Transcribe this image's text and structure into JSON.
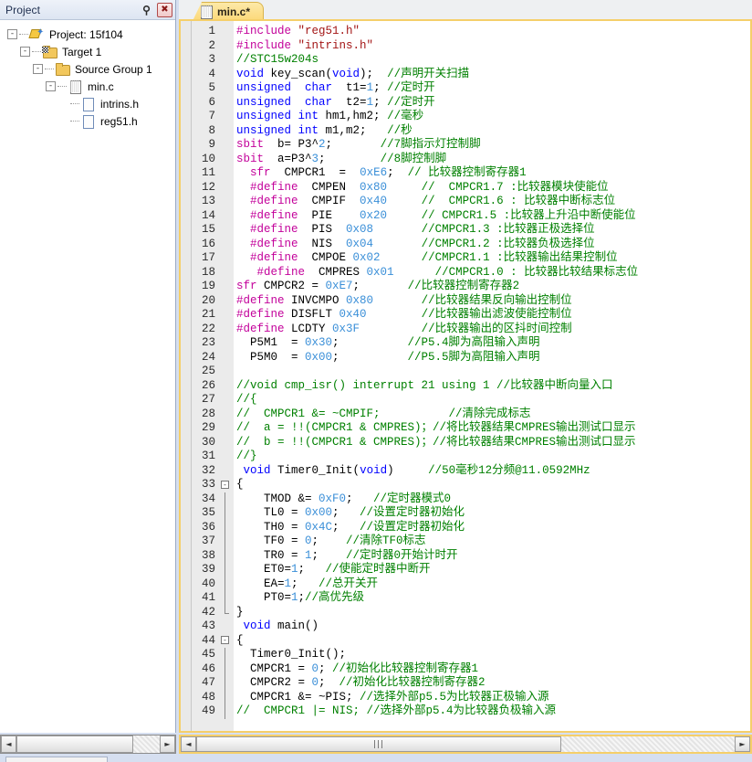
{
  "project_panel": {
    "title": "Project",
    "pin_icon": "pin-icon",
    "close_icon": "close-icon",
    "tree": [
      {
        "label": "Project: 15f104",
        "icon": "project-icon",
        "depth": 0,
        "expander": "-"
      },
      {
        "label": "Target 1",
        "icon": "target-folder-icon",
        "depth": 1,
        "expander": "-"
      },
      {
        "label": "Source Group 1",
        "icon": "folder-icon",
        "depth": 2,
        "expander": "-"
      },
      {
        "label": "min.c",
        "icon": "c-file-icon",
        "depth": 3,
        "expander": "-"
      },
      {
        "label": "intrins.h",
        "icon": "h-file-icon",
        "depth": 4,
        "expander": ""
      },
      {
        "label": "reg51.h",
        "icon": "h-file-icon",
        "depth": 4,
        "expander": ""
      }
    ]
  },
  "editor": {
    "tab_label": "min.c*",
    "tab_icon": "c-file-icon",
    "first_line": 1,
    "lines": [
      {
        "n": 1,
        "fold": "",
        "tokens": [
          {
            "t": "p",
            "v": "#include"
          },
          {
            "t": "t",
            "v": " "
          },
          {
            "t": "s",
            "v": "\"reg51.h\""
          }
        ]
      },
      {
        "n": 2,
        "fold": "",
        "tokens": [
          {
            "t": "p",
            "v": "#include"
          },
          {
            "t": "t",
            "v": " "
          },
          {
            "t": "s",
            "v": "\"intrins.h\""
          }
        ]
      },
      {
        "n": 3,
        "fold": "",
        "tokens": [
          {
            "t": "c",
            "v": "//STC15w204s"
          }
        ]
      },
      {
        "n": 4,
        "fold": "",
        "tokens": [
          {
            "t": "k",
            "v": "void"
          },
          {
            "t": "t",
            "v": " key_scan("
          },
          {
            "t": "k",
            "v": "void"
          },
          {
            "t": "t",
            "v": ");  "
          },
          {
            "t": "c",
            "v": "//声明开关扫描"
          }
        ]
      },
      {
        "n": 5,
        "fold": "",
        "tokens": [
          {
            "t": "k",
            "v": "unsigned"
          },
          {
            "t": "t",
            "v": "  "
          },
          {
            "t": "k",
            "v": "char"
          },
          {
            "t": "t",
            "v": "  t1="
          },
          {
            "t": "n",
            "v": "1"
          },
          {
            "t": "t",
            "v": "; "
          },
          {
            "t": "c",
            "v": "//定时开"
          }
        ]
      },
      {
        "n": 6,
        "fold": "",
        "tokens": [
          {
            "t": "k",
            "v": "unsigned"
          },
          {
            "t": "t",
            "v": "  "
          },
          {
            "t": "k",
            "v": "char"
          },
          {
            "t": "t",
            "v": "  t2="
          },
          {
            "t": "n",
            "v": "1"
          },
          {
            "t": "t",
            "v": "; "
          },
          {
            "t": "c",
            "v": "//定时开"
          }
        ]
      },
      {
        "n": 7,
        "fold": "",
        "tokens": [
          {
            "t": "k",
            "v": "unsigned"
          },
          {
            "t": "t",
            "v": " "
          },
          {
            "t": "k",
            "v": "int"
          },
          {
            "t": "t",
            "v": " hm1,hm2; "
          },
          {
            "t": "c",
            "v": "//毫秒"
          }
        ]
      },
      {
        "n": 8,
        "fold": "",
        "tokens": [
          {
            "t": "k",
            "v": "unsigned"
          },
          {
            "t": "t",
            "v": " "
          },
          {
            "t": "k",
            "v": "int"
          },
          {
            "t": "t",
            "v": " m1,m2;   "
          },
          {
            "t": "c",
            "v": "//秒"
          }
        ]
      },
      {
        "n": 9,
        "fold": "",
        "tokens": [
          {
            "t": "p",
            "v": "sbit"
          },
          {
            "t": "t",
            "v": "  b= P3^"
          },
          {
            "t": "n",
            "v": "2"
          },
          {
            "t": "t",
            "v": ";       "
          },
          {
            "t": "c",
            "v": "//7脚指示灯控制脚"
          }
        ]
      },
      {
        "n": 10,
        "fold": "",
        "tokens": [
          {
            "t": "p",
            "v": "sbit"
          },
          {
            "t": "t",
            "v": "  a=P3^"
          },
          {
            "t": "n",
            "v": "3"
          },
          {
            "t": "t",
            "v": ";        "
          },
          {
            "t": "c",
            "v": "//8脚控制脚"
          }
        ]
      },
      {
        "n": 11,
        "fold": "",
        "tokens": [
          {
            "t": "t",
            "v": "  "
          },
          {
            "t": "p",
            "v": "sfr"
          },
          {
            "t": "t",
            "v": "  CMPCR1  =  "
          },
          {
            "t": "n",
            "v": "0xE6"
          },
          {
            "t": "t",
            "v": ";  "
          },
          {
            "t": "c",
            "v": "// 比较器控制寄存器1"
          }
        ]
      },
      {
        "n": 12,
        "fold": "",
        "tokens": [
          {
            "t": "t",
            "v": "  "
          },
          {
            "t": "p",
            "v": "#define"
          },
          {
            "t": "t",
            "v": "  CMPEN  "
          },
          {
            "t": "n",
            "v": "0x80"
          },
          {
            "t": "t",
            "v": "     "
          },
          {
            "t": "c",
            "v": "//  CMPCR1.7 :比较器模块使能位"
          }
        ]
      },
      {
        "n": 13,
        "fold": "",
        "tokens": [
          {
            "t": "t",
            "v": "  "
          },
          {
            "t": "p",
            "v": "#define"
          },
          {
            "t": "t",
            "v": "  CMPIF  "
          },
          {
            "t": "n",
            "v": "0x40"
          },
          {
            "t": "t",
            "v": "     "
          },
          {
            "t": "c",
            "v": "//  CMPCR1.6 : 比较器中断标志位"
          }
        ]
      },
      {
        "n": 14,
        "fold": "",
        "tokens": [
          {
            "t": "t",
            "v": "  "
          },
          {
            "t": "p",
            "v": "#define"
          },
          {
            "t": "t",
            "v": "  PIE    "
          },
          {
            "t": "n",
            "v": "0x20"
          },
          {
            "t": "t",
            "v": "     "
          },
          {
            "t": "c",
            "v": "// CMPCR1.5 :比较器上升沿中断使能位"
          }
        ]
      },
      {
        "n": 15,
        "fold": "",
        "tokens": [
          {
            "t": "t",
            "v": "  "
          },
          {
            "t": "p",
            "v": "#define"
          },
          {
            "t": "t",
            "v": "  PIS  "
          },
          {
            "t": "n",
            "v": "0x08"
          },
          {
            "t": "t",
            "v": "       "
          },
          {
            "t": "c",
            "v": "//CMPCR1.3 :比较器正极选择位"
          }
        ]
      },
      {
        "n": 16,
        "fold": "",
        "tokens": [
          {
            "t": "t",
            "v": "  "
          },
          {
            "t": "p",
            "v": "#define"
          },
          {
            "t": "t",
            "v": "  NIS  "
          },
          {
            "t": "n",
            "v": "0x04"
          },
          {
            "t": "t",
            "v": "       "
          },
          {
            "t": "c",
            "v": "//CMPCR1.2 :比较器负极选择位"
          }
        ]
      },
      {
        "n": 17,
        "fold": "",
        "tokens": [
          {
            "t": "t",
            "v": "  "
          },
          {
            "t": "p",
            "v": "#define"
          },
          {
            "t": "t",
            "v": "  CMPOE "
          },
          {
            "t": "n",
            "v": "0x02"
          },
          {
            "t": "t",
            "v": "      "
          },
          {
            "t": "c",
            "v": "//CMPCR1.1 :比较器输出结果控制位"
          }
        ]
      },
      {
        "n": 18,
        "fold": "",
        "tokens": [
          {
            "t": "t",
            "v": "   "
          },
          {
            "t": "p",
            "v": "#define"
          },
          {
            "t": "t",
            "v": "  CMPRES "
          },
          {
            "t": "n",
            "v": "0x01"
          },
          {
            "t": "t",
            "v": "      "
          },
          {
            "t": "c",
            "v": "//CMPCR1.0 : 比较器比较结果标志位"
          }
        ]
      },
      {
        "n": 19,
        "fold": "",
        "tokens": [
          {
            "t": "p",
            "v": "sfr"
          },
          {
            "t": "t",
            "v": " CMPCR2 = "
          },
          {
            "t": "n",
            "v": "0xE7"
          },
          {
            "t": "t",
            "v": ";       "
          },
          {
            "t": "c",
            "v": "//比较器控制寄存器2"
          }
        ]
      },
      {
        "n": 20,
        "fold": "",
        "tokens": [
          {
            "t": "p",
            "v": "#define"
          },
          {
            "t": "t",
            "v": " INVCMPO "
          },
          {
            "t": "n",
            "v": "0x80"
          },
          {
            "t": "t",
            "v": "       "
          },
          {
            "t": "c",
            "v": "//比较器结果反向输出控制位"
          }
        ]
      },
      {
        "n": 21,
        "fold": "",
        "tokens": [
          {
            "t": "p",
            "v": "#define"
          },
          {
            "t": "t",
            "v": " DISFLT "
          },
          {
            "t": "n",
            "v": "0x40"
          },
          {
            "t": "t",
            "v": "        "
          },
          {
            "t": "c",
            "v": "//比较器输出滤波使能控制位"
          }
        ]
      },
      {
        "n": 22,
        "fold": "",
        "tokens": [
          {
            "t": "p",
            "v": "#define"
          },
          {
            "t": "t",
            "v": " LCDTY "
          },
          {
            "t": "n",
            "v": "0x3F"
          },
          {
            "t": "t",
            "v": "         "
          },
          {
            "t": "c",
            "v": "//比较器输出的区抖时间控制"
          }
        ]
      },
      {
        "n": 23,
        "fold": "",
        "tokens": [
          {
            "t": "t",
            "v": "  P5M1  = "
          },
          {
            "t": "n",
            "v": "0x30"
          },
          {
            "t": "t",
            "v": ";          "
          },
          {
            "t": "c",
            "v": "//P5.4脚为高阻输入声明"
          }
        ]
      },
      {
        "n": 24,
        "fold": "",
        "tokens": [
          {
            "t": "t",
            "v": "  P5M0  = "
          },
          {
            "t": "n",
            "v": "0x00"
          },
          {
            "t": "t",
            "v": ";          "
          },
          {
            "t": "c",
            "v": "//P5.5脚为高阻输入声明"
          }
        ]
      },
      {
        "n": 25,
        "fold": "",
        "tokens": []
      },
      {
        "n": 26,
        "fold": "",
        "tokens": [
          {
            "t": "c",
            "v": "//void cmp_isr() interrupt 21 using 1 //比较器中断向量入口"
          }
        ]
      },
      {
        "n": 27,
        "fold": "",
        "tokens": [
          {
            "t": "c",
            "v": "//{"
          }
        ]
      },
      {
        "n": 28,
        "fold": "",
        "tokens": [
          {
            "t": "c",
            "v": "//  CMPCR1 &= ~CMPIF;          //清除完成标志"
          }
        ]
      },
      {
        "n": 29,
        "fold": "",
        "tokens": [
          {
            "t": "c",
            "v": "//  a = !!(CMPCR1 & CMPRES)；//将比较器结果CMPRES输出测试口显示"
          }
        ]
      },
      {
        "n": 30,
        "fold": "",
        "tokens": [
          {
            "t": "c",
            "v": "//  b = !!(CMPCR1 & CMPRES)；//将比较器结果CMPRES输出测试口显示"
          }
        ]
      },
      {
        "n": 31,
        "fold": "",
        "tokens": [
          {
            "t": "c",
            "v": "//}"
          }
        ]
      },
      {
        "n": 32,
        "fold": "",
        "tokens": [
          {
            "t": "t",
            "v": " "
          },
          {
            "t": "k",
            "v": "void"
          },
          {
            "t": "t",
            "v": " Timer0_Init("
          },
          {
            "t": "k",
            "v": "void"
          },
          {
            "t": "t",
            "v": ")     "
          },
          {
            "t": "c",
            "v": "//50毫秒12分频@11.0592MHz"
          }
        ]
      },
      {
        "n": 33,
        "fold": "open",
        "tokens": [
          {
            "t": "t",
            "v": "{"
          }
        ]
      },
      {
        "n": 34,
        "fold": "bar",
        "tokens": [
          {
            "t": "t",
            "v": "    TMOD &= "
          },
          {
            "t": "n",
            "v": "0xF0"
          },
          {
            "t": "t",
            "v": ";   "
          },
          {
            "t": "c",
            "v": "//定时器模式0"
          }
        ]
      },
      {
        "n": 35,
        "fold": "bar",
        "tokens": [
          {
            "t": "t",
            "v": "    TL0 = "
          },
          {
            "t": "n",
            "v": "0x00"
          },
          {
            "t": "t",
            "v": ";   "
          },
          {
            "t": "c",
            "v": "//设置定时器初始化"
          }
        ]
      },
      {
        "n": 36,
        "fold": "bar",
        "tokens": [
          {
            "t": "t",
            "v": "    TH0 = "
          },
          {
            "t": "n",
            "v": "0x4C"
          },
          {
            "t": "t",
            "v": ";   "
          },
          {
            "t": "c",
            "v": "//设置定时器初始化"
          }
        ]
      },
      {
        "n": 37,
        "fold": "bar",
        "tokens": [
          {
            "t": "t",
            "v": "    TF0 = "
          },
          {
            "t": "n",
            "v": "0"
          },
          {
            "t": "t",
            "v": ";    "
          },
          {
            "t": "c",
            "v": "//清除TF0标志"
          }
        ]
      },
      {
        "n": 38,
        "fold": "bar",
        "tokens": [
          {
            "t": "t",
            "v": "    TR0 = "
          },
          {
            "t": "n",
            "v": "1"
          },
          {
            "t": "t",
            "v": ";    "
          },
          {
            "t": "c",
            "v": "//定时器0开始计时开"
          }
        ]
      },
      {
        "n": 39,
        "fold": "bar",
        "tokens": [
          {
            "t": "t",
            "v": "    ET0="
          },
          {
            "t": "n",
            "v": "1"
          },
          {
            "t": "t",
            "v": ";   "
          },
          {
            "t": "c",
            "v": "//使能定时器中断开"
          }
        ]
      },
      {
        "n": 40,
        "fold": "bar",
        "tokens": [
          {
            "t": "t",
            "v": "    EA="
          },
          {
            "t": "n",
            "v": "1"
          },
          {
            "t": "t",
            "v": ";   "
          },
          {
            "t": "c",
            "v": "//总开关开"
          }
        ]
      },
      {
        "n": 41,
        "fold": "bar",
        "tokens": [
          {
            "t": "t",
            "v": "    PT0="
          },
          {
            "t": "n",
            "v": "1"
          },
          {
            "t": "t",
            "v": ";"
          },
          {
            "t": "c",
            "v": "//高优先级"
          }
        ]
      },
      {
        "n": 42,
        "fold": "close",
        "tokens": [
          {
            "t": "t",
            "v": "}"
          }
        ]
      },
      {
        "n": 43,
        "fold": "",
        "tokens": [
          {
            "t": "t",
            "v": " "
          },
          {
            "t": "k",
            "v": "void"
          },
          {
            "t": "t",
            "v": " main()"
          }
        ]
      },
      {
        "n": 44,
        "fold": "open",
        "tokens": [
          {
            "t": "t",
            "v": "{"
          }
        ]
      },
      {
        "n": 45,
        "fold": "bar",
        "tokens": [
          {
            "t": "t",
            "v": "  Timer0_Init();"
          }
        ]
      },
      {
        "n": 46,
        "fold": "bar",
        "tokens": [
          {
            "t": "t",
            "v": "  CMPCR1 = "
          },
          {
            "t": "n",
            "v": "0"
          },
          {
            "t": "t",
            "v": "; "
          },
          {
            "t": "c",
            "v": "//初始化比较器控制寄存器1"
          }
        ]
      },
      {
        "n": 47,
        "fold": "bar",
        "tokens": [
          {
            "t": "t",
            "v": "  CMPCR2 = "
          },
          {
            "t": "n",
            "v": "0"
          },
          {
            "t": "t",
            "v": ";  "
          },
          {
            "t": "c",
            "v": "//初始化比较器控制寄存器2"
          }
        ]
      },
      {
        "n": 48,
        "fold": "bar",
        "tokens": [
          {
            "t": "t",
            "v": "  CMPCR1 &= ~PIS; "
          },
          {
            "t": "c",
            "v": "//选择外部p5.5为比较器正极输入源"
          }
        ]
      },
      {
        "n": 49,
        "fold": "bar",
        "tokens": [
          {
            "t": "c",
            "v": "//  CMPCR1 |= NIS; //选择外部p5.4为比较器负极输入源"
          }
        ]
      }
    ]
  },
  "scrollbars": {
    "left_arrow": "◄",
    "right_arrow": "►",
    "grip": "|||"
  },
  "colors": {
    "keyword": "#0000ff",
    "preprocessor": "#c3009a",
    "string": "#a31515",
    "comment": "#008000",
    "number": "#3a8fd8",
    "tab_accent": "#f5cf6a",
    "gutter": "#ebebeb"
  }
}
